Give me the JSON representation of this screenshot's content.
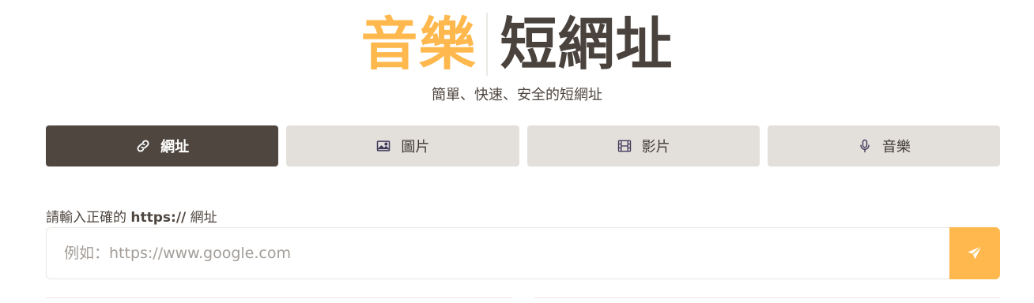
{
  "header": {
    "logo_accent": "音樂",
    "logo_main": "短網址",
    "subtitle": "簡單、快速、安全的短網址"
  },
  "tabs": [
    {
      "label": "網址",
      "icon": "link-icon",
      "active": true
    },
    {
      "label": "圖片",
      "icon": "image-icon",
      "active": false
    },
    {
      "label": "影片",
      "icon": "film-icon",
      "active": false
    },
    {
      "label": "音樂",
      "icon": "microphone-icon",
      "active": false
    }
  ],
  "form": {
    "label_prefix": "請輸入正確的 ",
    "label_bold": "https://",
    "label_suffix": " 網址",
    "placeholder": "例如：https://www.google.com",
    "value": "",
    "submit_icon": "send-icon"
  },
  "colors": {
    "accent": "#ffb84d",
    "dark": "#4f4640",
    "tab_bg": "#e3dfdb"
  }
}
